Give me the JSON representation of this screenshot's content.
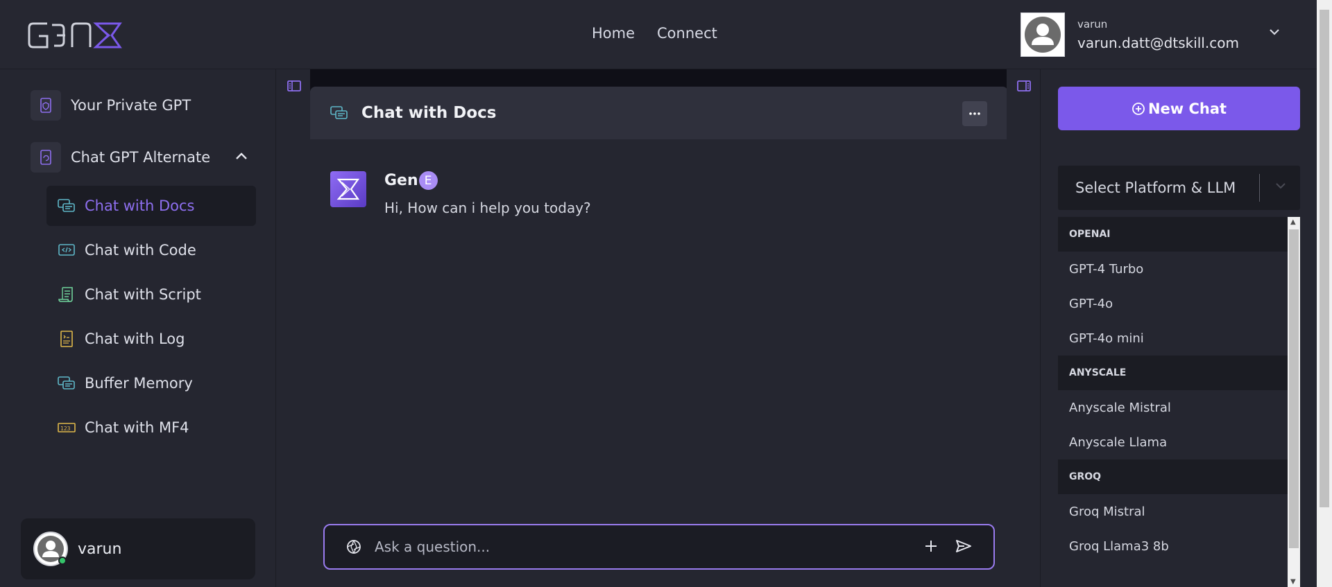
{
  "header": {
    "logo_text": "GENΣ",
    "nav": [
      "Home",
      "Connect"
    ],
    "user_name": "varun",
    "user_email": "varun.datt@dtskill.com"
  },
  "sidebar": {
    "sections": [
      {
        "label": "Your Private GPT"
      },
      {
        "label": "Chat GPT Alternate"
      }
    ],
    "items": [
      {
        "label": "Chat with Docs",
        "active": true
      },
      {
        "label": "Chat with Code"
      },
      {
        "label": "Chat with Script"
      },
      {
        "label": "Chat with Log"
      },
      {
        "label": "Buffer Memory"
      },
      {
        "label": "Chat with MF4"
      }
    ],
    "user_name": "varun"
  },
  "chat": {
    "title": "Chat with Docs",
    "author": "Gen",
    "author_badge": "E",
    "greeting": "Hi, How can i help you today?",
    "input_placeholder": "Ask a question..."
  },
  "right_panel": {
    "new_chat_label": "New Chat",
    "select_placeholder": "Select Platform & LLM",
    "groups": [
      {
        "name": "OPENAI",
        "options": [
          "GPT-4 Turbo",
          "GPT-4o",
          "GPT-4o mini"
        ]
      },
      {
        "name": "ANYSCALE",
        "options": [
          "Anyscale Mistral",
          "Anyscale Llama"
        ]
      },
      {
        "name": "GROQ",
        "options": [
          "Groq Mistral",
          "Groq Llama3 8b"
        ]
      }
    ]
  },
  "colors": {
    "accent": "#7b59ea",
    "background": "#252630",
    "active_text": "#8e6ff0"
  }
}
